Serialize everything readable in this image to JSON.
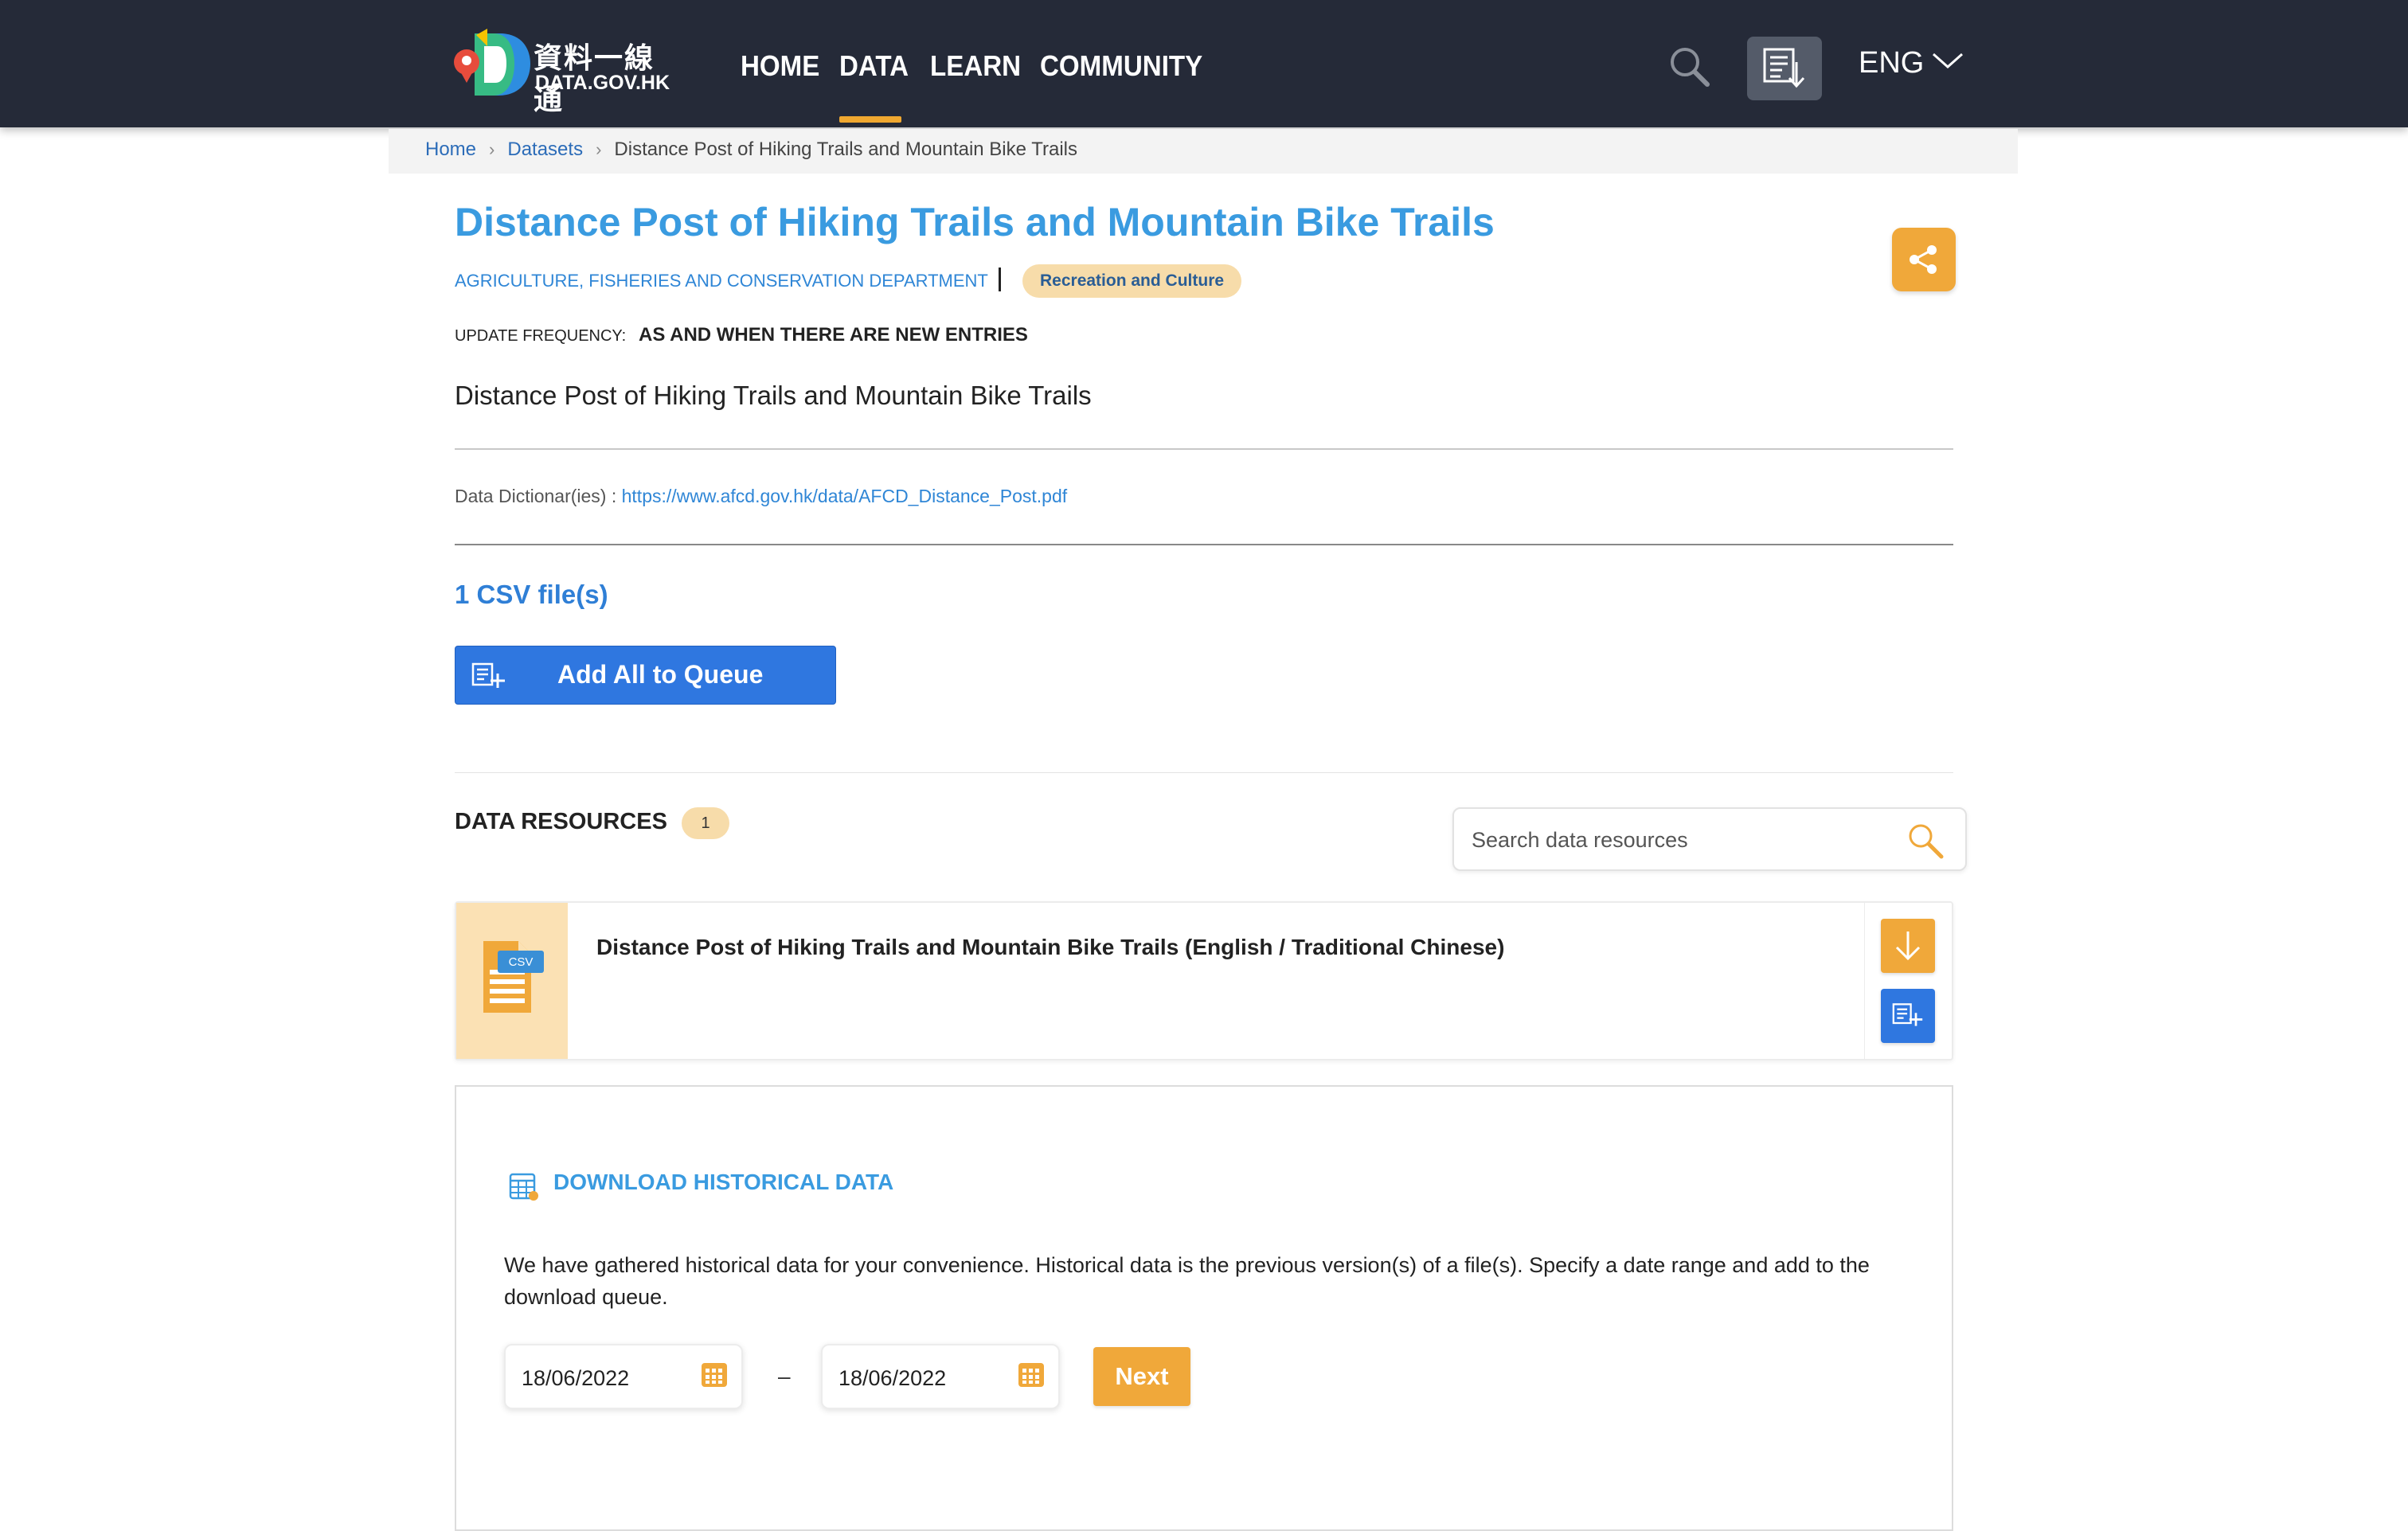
{
  "nav": {
    "logo_zh": "資料一線通",
    "logo_en": "DATA.GOV.HK",
    "links": [
      "HOME",
      "DATA",
      "LEARN",
      "COMMUNITY"
    ],
    "active": "DATA",
    "language": "ENG"
  },
  "breadcrumb": [
    "Home",
    "Datasets",
    "Distance Post of Hiking Trails and Mountain Bike Trails"
  ],
  "dataset": {
    "title": "Distance Post of Hiking Trails and Mountain Bike Trails",
    "department": "AGRICULTURE, FISHERIES AND CONSERVATION DEPARTMENT",
    "category": "Recreation and Culture",
    "update_frequency_label": "UPDATE FREQUENCY:",
    "update_frequency": "AS AND WHEN THERE ARE NEW ENTRIES",
    "description": "Distance Post of Hiking Trails and Mountain Bike Trails",
    "dictionary_label": "Data Dictionar(ies) :",
    "dictionary_url": "https://www.afcd.gov.hk/data/AFCD_Distance_Post.pdf",
    "file_count": "1 CSV file(s)",
    "add_all_label": "Add All to Queue"
  },
  "resources": {
    "title": "DATA RESOURCES",
    "count": "1",
    "search_placeholder": "Search data resources",
    "items": [
      {
        "format": "CSV",
        "title": "Distance Post of Hiking Trails and Mountain Bike Trails (English / Traditional Chinese)"
      }
    ]
  },
  "historical": {
    "title": "DOWNLOAD HISTORICAL DATA",
    "description": "We have gathered historical data for your convenience. Historical data is the previous version(s) of a file(s). Specify a date range and add to the download queue.",
    "start_date": "18/06/2022",
    "end_date": "18/06/2022",
    "separator": "–",
    "next_label": "Next"
  },
  "colors": {
    "navbar": "#252a38",
    "accent_orange": "#f0a83a",
    "primary_blue": "#2f77e0",
    "title_blue": "#3a9be0",
    "badge": "#f7dcaa"
  },
  "icons": [
    "logo-icon",
    "search-icon",
    "download-queue-icon",
    "chevron-down-icon",
    "share-icon",
    "add-queue-icon",
    "csv-file-icon",
    "download-icon",
    "calendar-icon"
  ]
}
